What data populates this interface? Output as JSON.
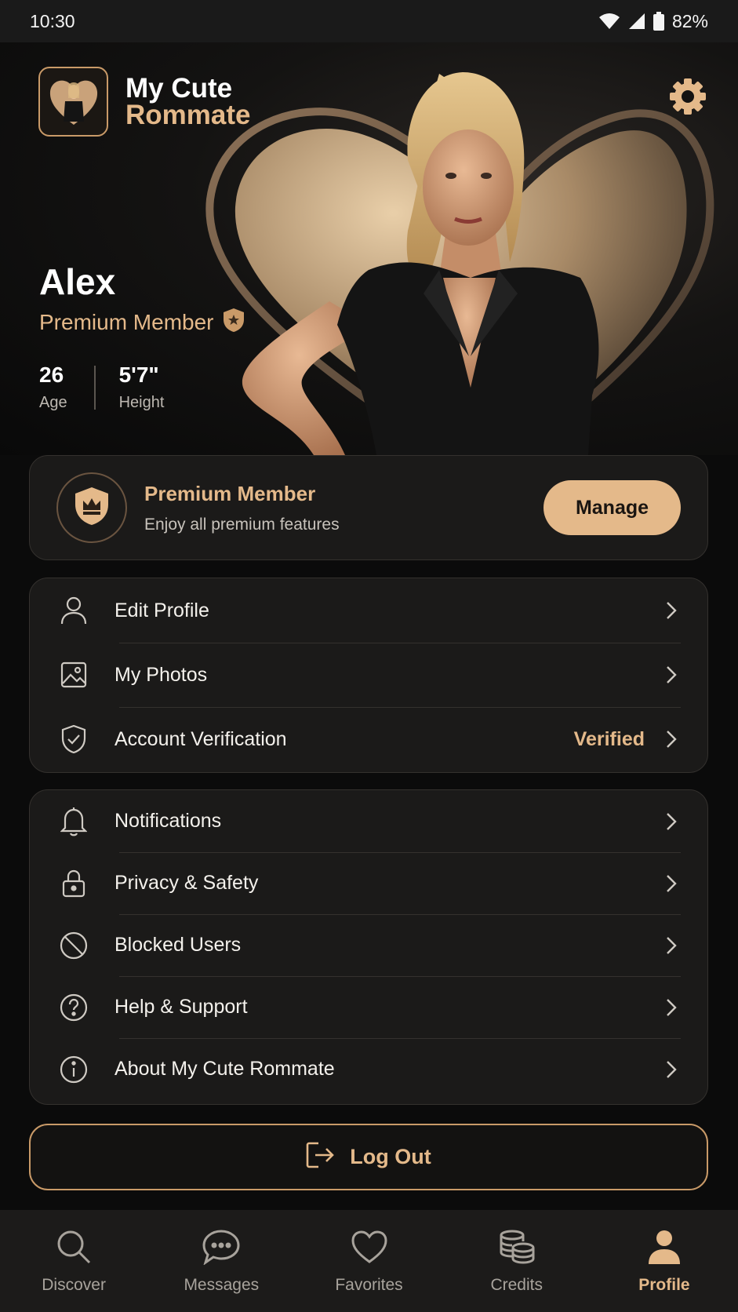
{
  "status_bar": {
    "time": "10:30",
    "battery": "82%"
  },
  "app": {
    "name_line1": "My Cute",
    "name_line2": "Rommate"
  },
  "profile": {
    "name": "Alex",
    "membership": "Premium Member",
    "stats": [
      {
        "value": "26",
        "label": "Age"
      },
      {
        "value": "5'7\"",
        "label": "Height"
      }
    ]
  },
  "premium_card": {
    "title": "Premium Member",
    "subtitle": "Enjoy all premium features",
    "manage_label": "Manage"
  },
  "menu_group_1": [
    {
      "label": "Edit Profile",
      "icon": "user-icon"
    },
    {
      "label": "My Photos",
      "icon": "photo-icon"
    },
    {
      "label": "Account Verification",
      "icon": "shield-check-icon",
      "value": "Verified"
    }
  ],
  "menu_group_2": [
    {
      "label": "Notifications",
      "icon": "bell-icon"
    },
    {
      "label": "Privacy & Safety",
      "icon": "lock-icon"
    },
    {
      "label": "Blocked Users",
      "icon": "block-icon"
    },
    {
      "label": "Help & Support",
      "icon": "help-icon"
    },
    {
      "label": "About My Cute Rommate",
      "icon": "info-icon"
    }
  ],
  "logout_label": "Log Out",
  "bottom_nav": [
    {
      "label": "Discover",
      "icon": "search-icon"
    },
    {
      "label": "Messages",
      "icon": "chat-icon"
    },
    {
      "label": "Favorites",
      "icon": "heart-icon"
    },
    {
      "label": "Credits",
      "icon": "coins-icon"
    },
    {
      "label": "Profile",
      "icon": "profile-icon",
      "active": true
    }
  ],
  "colors": {
    "accent": "#e4b98a",
    "background": "#0b0b0b",
    "card": "#1b1a19"
  }
}
